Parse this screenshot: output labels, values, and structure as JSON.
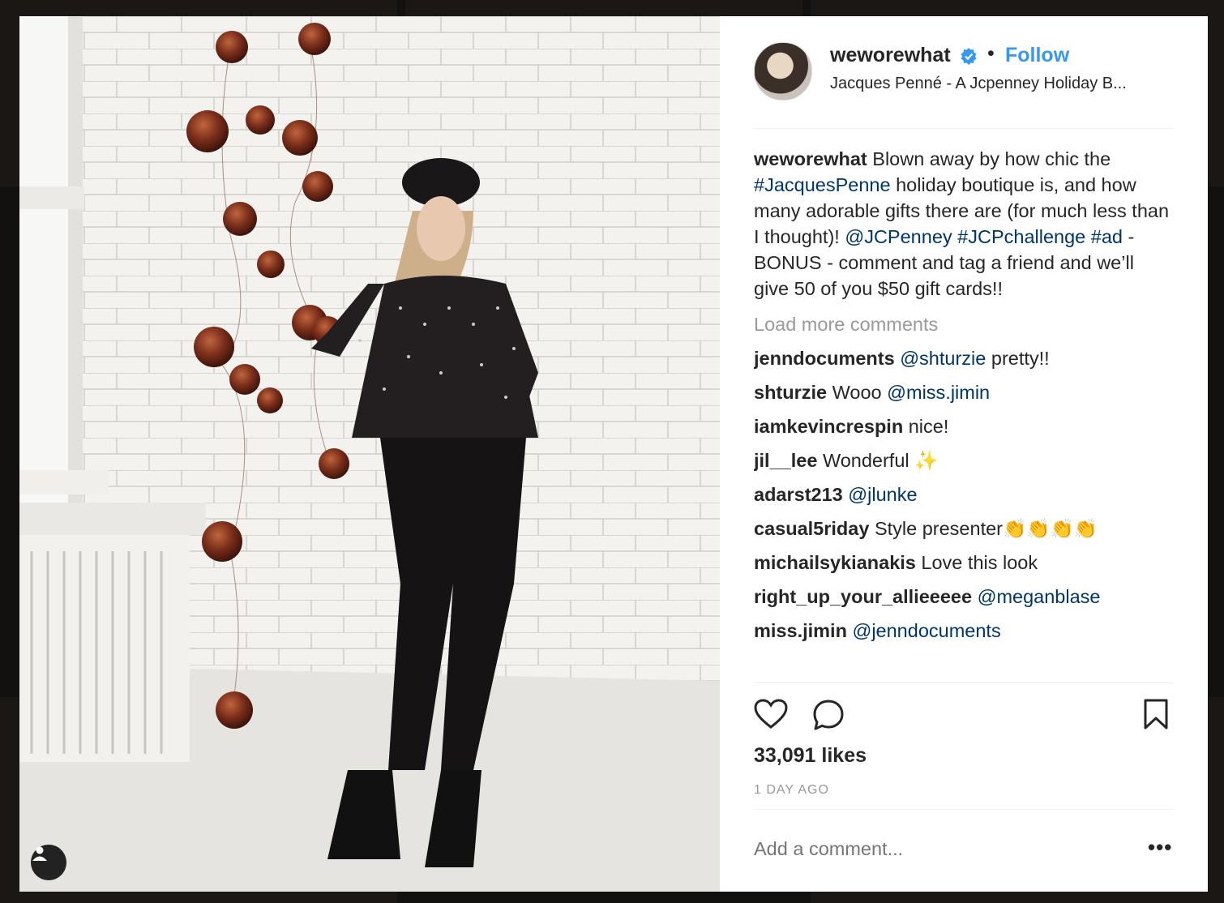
{
  "post": {
    "username": "weworewhat",
    "follow_label": "Follow",
    "dot": "•",
    "location": "Jacques Penné - A Jcpenney Holiday B...",
    "caption": {
      "user": "weworewhat",
      "text1": "Blown away by how chic the",
      "tag1": "#JacquesPenne",
      "text2": "holiday boutique is, and how many adorable gifts there are (for much less than I thought)!",
      "mention1": "@JCPenney",
      "tag2": "#JCPchallenge",
      "tag3": "#ad",
      "text3": "- BONUS - comment and tag a friend and we’ll give 50 of you $50 gift cards!!"
    },
    "load_more": "Load more comments",
    "comments": [
      {
        "user": "jenndocuments",
        "mention": "@shturzie",
        "text": "pretty!!"
      },
      {
        "user": "shturzie",
        "text": "Wooo",
        "mention": "@miss.jimin"
      },
      {
        "user": "iamkevincrespin",
        "text": "nice!"
      },
      {
        "user": "jil__lee",
        "text": "Wonderful ✨"
      },
      {
        "user": "adarst213",
        "mention": "@jlunke"
      },
      {
        "user": "casual5riday",
        "text": "Style presenter👏👏👏👏"
      },
      {
        "user": "michailsykianakis",
        "text": "Love this look"
      },
      {
        "user": "right_up_your_allieeeee",
        "mention": "@meganblase"
      },
      {
        "user": "miss.jimin",
        "mention": "@jenndocuments"
      }
    ],
    "likes": "33,091 likes",
    "time": "1 DAY AGO",
    "add_comment_placeholder": "Add a comment...",
    "more_options": "•••"
  },
  "icons": {
    "verified": "verified-badge-icon",
    "like": "heart-icon",
    "comment": "comment-bubble-icon",
    "save": "bookmark-icon",
    "tag": "user-tag-icon"
  },
  "colors": {
    "link": "#003569",
    "follow": "#3897f0",
    "muted": "#999999",
    "text": "#262626"
  }
}
